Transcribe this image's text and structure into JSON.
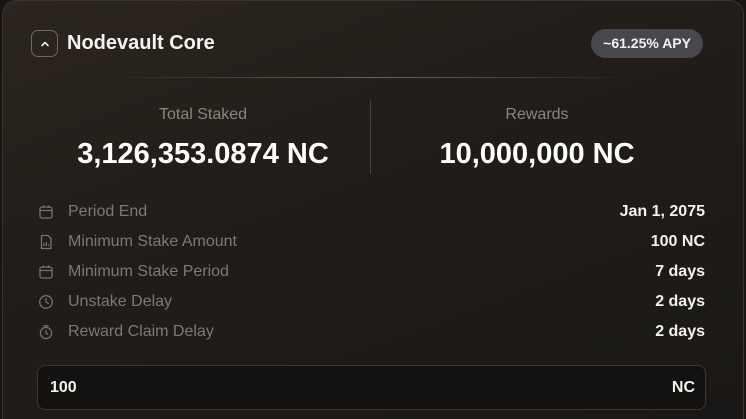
{
  "pool": {
    "title": "Nodevault Core",
    "apy_badge": "~61.25% APY"
  },
  "stats": {
    "total_staked_label": "Total Staked",
    "total_staked_value": "3,126,353.0874 NC",
    "rewards_label": "Rewards",
    "rewards_value": "10,000,000 NC"
  },
  "details": [
    {
      "icon": "calendar-icon",
      "label": "Period End",
      "value": "Jan 1, 2075"
    },
    {
      "icon": "document-chart-icon",
      "label": "Minimum Stake Amount",
      "value": "100 NC"
    },
    {
      "icon": "calendar-icon",
      "label": "Minimum Stake Period",
      "value": "7 days"
    },
    {
      "icon": "clock-icon",
      "label": "Unstake Delay",
      "value": "2 days"
    },
    {
      "icon": "stopwatch-icon",
      "label": "Reward Claim Delay",
      "value": "2 days"
    }
  ],
  "amount_input": {
    "value": "100",
    "unit": "NC"
  },
  "colors": {
    "badge_bg": "#48474b",
    "muted_text": "#7f7872",
    "card_bg": "#221d19"
  }
}
